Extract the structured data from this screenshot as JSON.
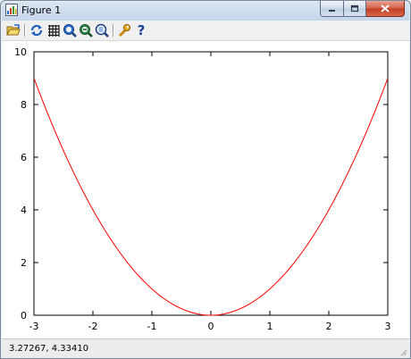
{
  "window": {
    "title": "Figure 1"
  },
  "toolbar": {
    "items": [
      {
        "name": "open-folder-icon"
      },
      {
        "name": "refresh-icon"
      },
      {
        "name": "grid-icon"
      },
      {
        "name": "zoom-in-icon"
      },
      {
        "name": "zoom-out-icon"
      },
      {
        "name": "zoom-autoscale-icon"
      },
      {
        "name": "settings-wrench-icon"
      },
      {
        "name": "help-icon",
        "label": "?"
      }
    ]
  },
  "status": {
    "coords": "3.27267,  4.33410"
  },
  "chart_data": {
    "type": "line",
    "title": "",
    "xlabel": "",
    "ylabel": "",
    "xlim": [
      -3,
      3
    ],
    "ylim": [
      0,
      10
    ],
    "xticks": [
      "-3",
      "-2",
      "-1",
      "0",
      "1",
      "2",
      "3"
    ],
    "yticks": [
      "0",
      "2",
      "4",
      "6",
      "8",
      "10"
    ],
    "grid": false,
    "series": [
      {
        "color": "#ff0000",
        "x": [
          -3,
          -2.5,
          -2,
          -1.5,
          -1,
          -0.5,
          0,
          0.5,
          1,
          1.5,
          2,
          2.5,
          3
        ],
        "y": [
          9,
          6.25,
          4,
          2.25,
          1,
          0.25,
          0,
          0.25,
          1,
          2.25,
          4,
          6.25,
          9
        ]
      }
    ]
  }
}
